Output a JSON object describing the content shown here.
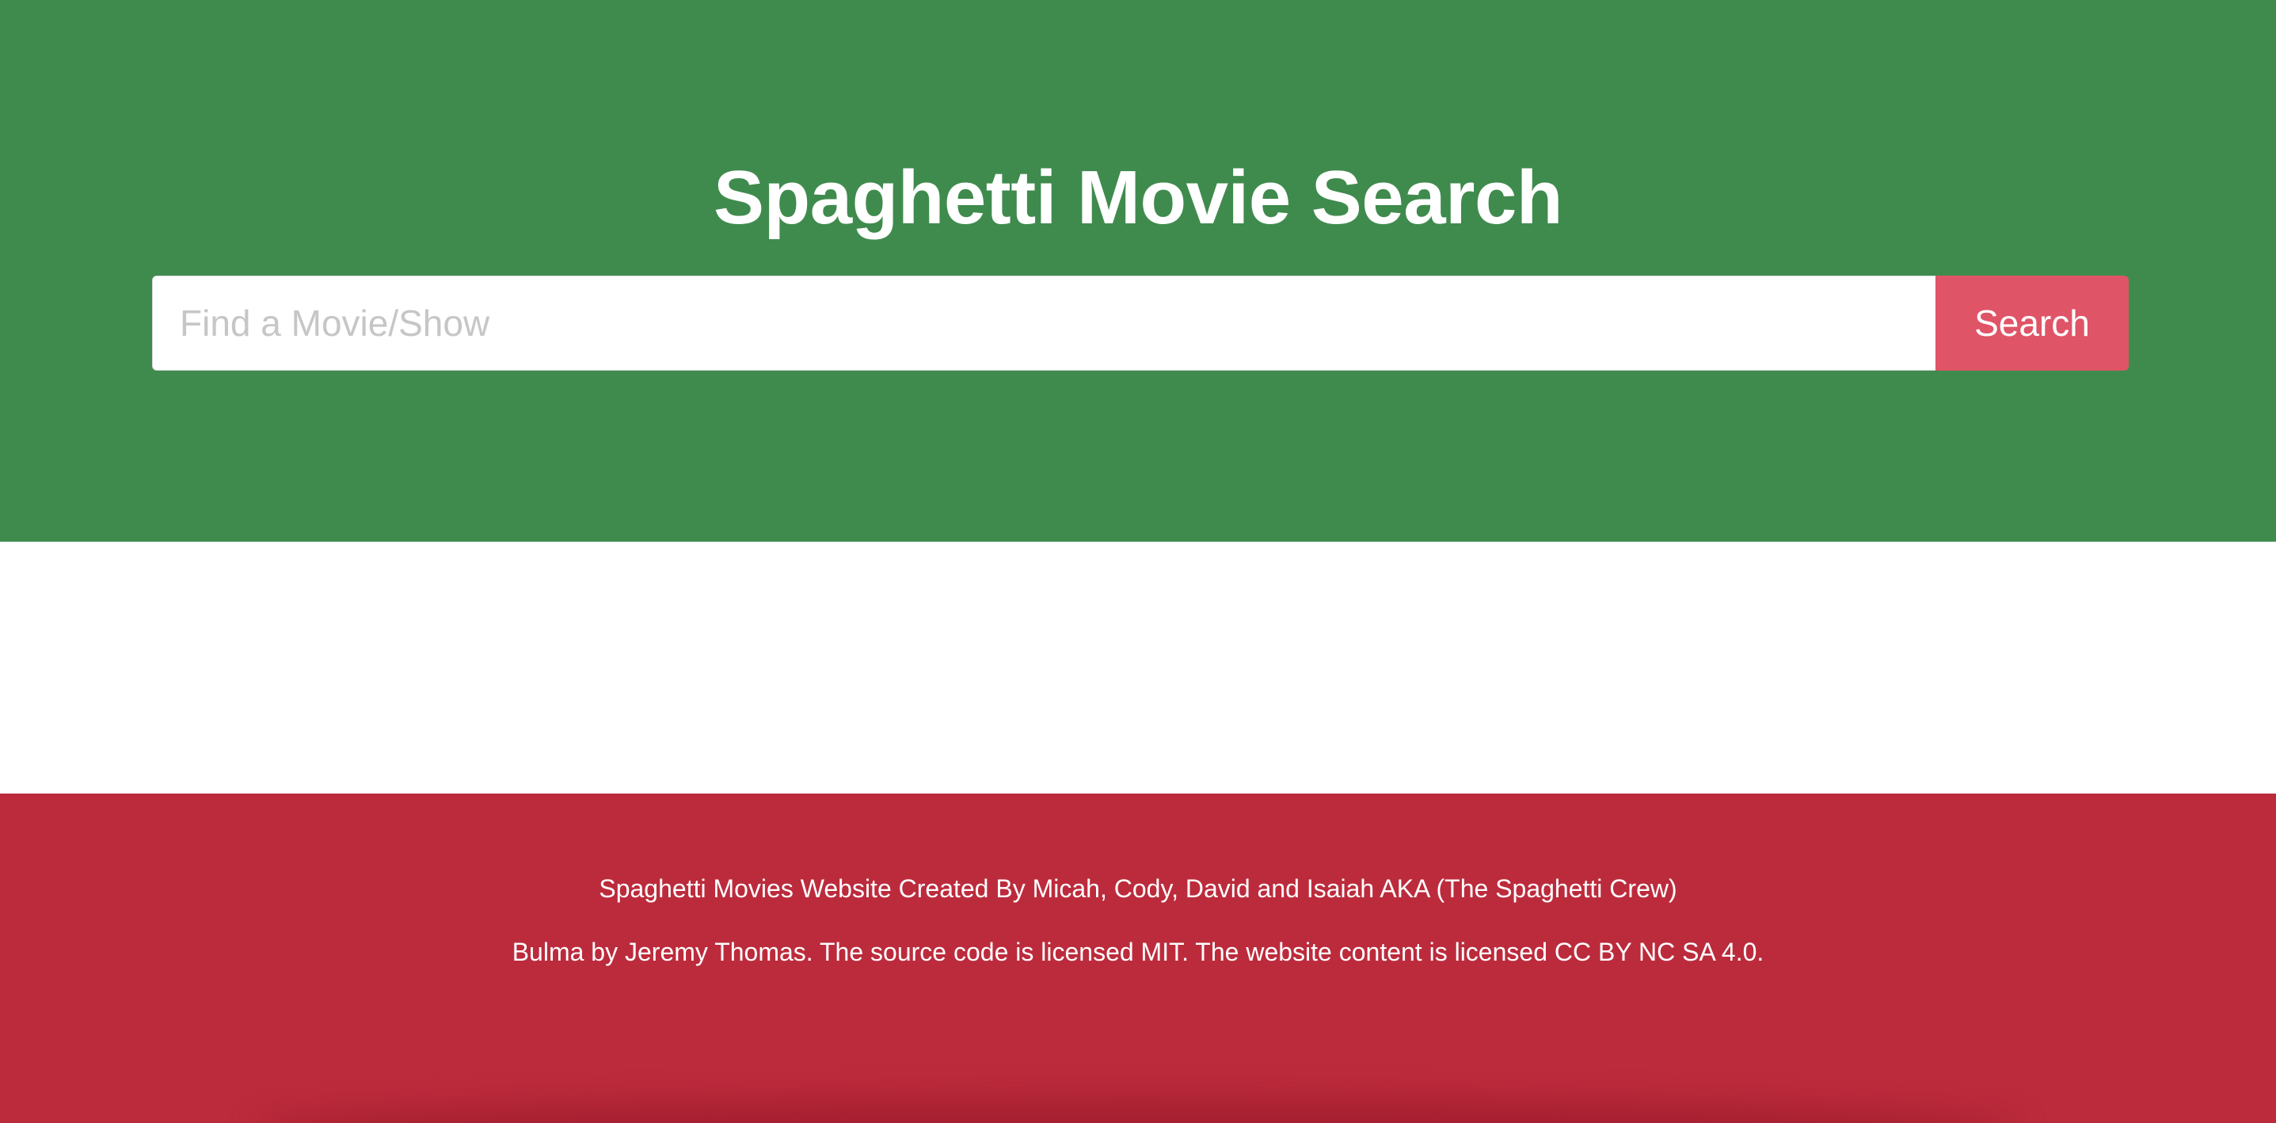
{
  "hero": {
    "title": "Spaghetti Movie Search",
    "background_color": "#3f8b4e"
  },
  "search": {
    "value": "",
    "placeholder": "Find a Movie/Show",
    "button_label": "Search",
    "button_color": "#e05467"
  },
  "footer": {
    "background_color": "#bc2b3c",
    "credits": "Spaghetti Movies Website Created By Micah, Cody, David and Isaiah AKA (The Spaghetti Crew)",
    "license": "Bulma by Jeremy Thomas. The source code is licensed MIT. The website content is licensed CC BY NC SA 4.0."
  }
}
